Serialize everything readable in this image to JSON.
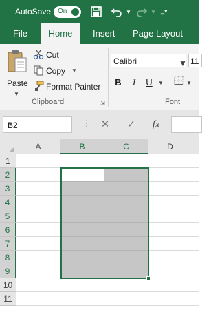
{
  "titlebar": {
    "autosave_label": "AutoSave",
    "autosave_state": "On",
    "icons": [
      "save-icon",
      "undo-icon",
      "redo-icon",
      "customize-toolbar-icon"
    ]
  },
  "tabs": [
    {
      "label": "File",
      "active": false
    },
    {
      "label": "Home",
      "active": true
    },
    {
      "label": "Insert",
      "active": false
    },
    {
      "label": "Page Layout",
      "active": false
    }
  ],
  "clipboard": {
    "paste_label": "Paste",
    "cut_label": "Cut",
    "copy_label": "Copy",
    "format_painter_label": "Format Painter",
    "group_label": "Clipboard"
  },
  "font": {
    "font_name": "Calibri",
    "font_size": "11",
    "bold": "B",
    "italic": "I",
    "underline": "U",
    "group_label": "Font"
  },
  "formula_bar": {
    "name_box": "B2",
    "fx_label": "fx",
    "formula_value": ""
  },
  "sheet": {
    "columns": [
      "A",
      "B",
      "C",
      "D"
    ],
    "selected_columns": [
      "B",
      "C"
    ],
    "rows": [
      "1",
      "2",
      "3",
      "4",
      "5",
      "6",
      "7",
      "8",
      "9",
      "10",
      "11"
    ],
    "selected_rows": [
      "2",
      "3",
      "4",
      "5",
      "6",
      "7",
      "8",
      "9"
    ],
    "active_cell": "B2",
    "selection_range": "B2:C9"
  },
  "colors": {
    "accent": "#217346",
    "selection_fill": "#c6c6c6",
    "header_bg": "#e6e6e6"
  }
}
